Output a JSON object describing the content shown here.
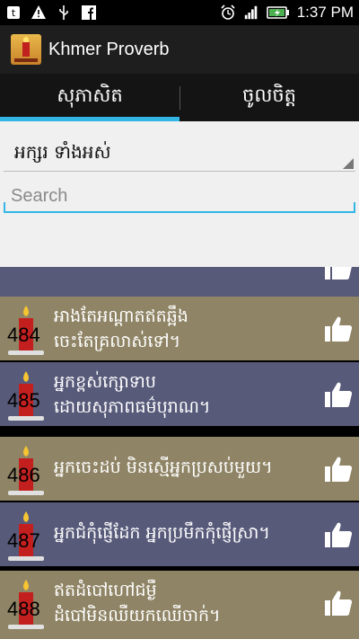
{
  "app": {
    "title": "Khmer Proverb"
  },
  "status_bar": {
    "time": "1:37 PM"
  },
  "tabs": [
    {
      "label": "សុភាសិត",
      "active": true
    },
    {
      "label": "ចូលចិត្ត",
      "active": false
    }
  ],
  "filter": {
    "selected": "អក្សរ ទាំងអស់"
  },
  "search": {
    "placeholder": "Search",
    "value": ""
  },
  "proverbs": [
    {
      "number": "484",
      "line1": "អាងតែអណ្ដាតឥតឆ្អឹង",
      "line2": "ចេះតែគ្រលាស់ទៅ។"
    },
    {
      "number": "485",
      "line1": "អ្នកខ្ពស់ក្សោទាប",
      "line2": "ដោយសុភាពធម៌បុរាណ។"
    },
    {
      "number": "486",
      "line1": "អ្នកចេះដប់ មិនស្មើអ្នកប្រសប់មួយ។",
      "line2": ""
    },
    {
      "number": "487",
      "line1": "អ្នកជំកុំផ្ញើដែក អ្នកប្រមឹកកុំផ្ញើស្រា។",
      "line2": ""
    },
    {
      "number": "488",
      "line1": "ឥតដំបៅហៅជម្ងឺ",
      "line2": "ដំបៅមិនឈឺយកឈើចាក់។"
    }
  ],
  "colors": {
    "accent": "#33b5e5",
    "row_blue": "#585a7a",
    "row_tan": "#8f8465"
  }
}
